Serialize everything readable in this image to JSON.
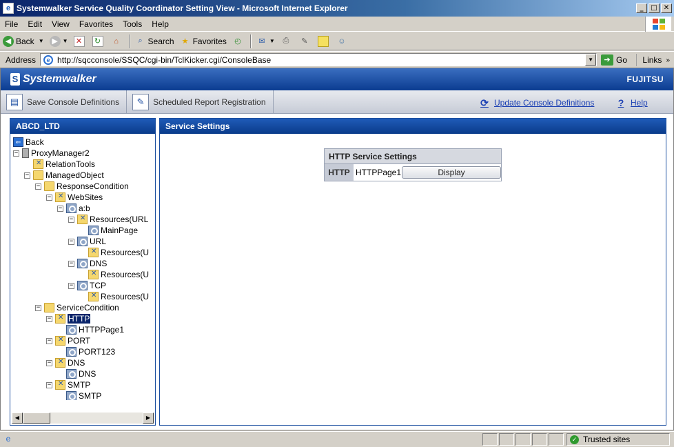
{
  "window": {
    "title": "Systemwalker Service Quality Coordinator Setting View - Microsoft Internet Explorer"
  },
  "menu": [
    "File",
    "Edit",
    "View",
    "Favorites",
    "Tools",
    "Help"
  ],
  "toolbar": {
    "back": "Back",
    "search": "Search",
    "favorites": "Favorites"
  },
  "address": {
    "label": "Address",
    "url": "http://sqcconsole/SSQC/cgi-bin/TclKicker.cgi/ConsoleBase",
    "go": "Go",
    "links": "Links"
  },
  "banner": {
    "product": "Systemwalker",
    "vendor": "FUJITSU"
  },
  "commands": {
    "save": "Save Console Definitions",
    "report": "Scheduled Report Registration",
    "update": "Update Console Definitions",
    "help": "Help"
  },
  "left_panel": {
    "title": "ABCD_LTD"
  },
  "tree": [
    {
      "label": "Back",
      "icon": "back-icon"
    },
    {
      "label": "ProxyManager2",
      "icon": "server-icon"
    },
    {
      "label": "RelationTools",
      "icon": "tool-icon"
    },
    {
      "label": "ManagedObject",
      "icon": "folder-icon"
    },
    {
      "label": "ResponseCondition",
      "icon": "folder-icon"
    },
    {
      "label": "WebSites",
      "icon": "tool-icon"
    },
    {
      "label": "a:b",
      "icon": "object-icon"
    },
    {
      "label": "Resources(URL",
      "icon": "tool-icon"
    },
    {
      "label": "MainPage",
      "icon": "object-icon"
    },
    {
      "label": "URL",
      "icon": "object-icon"
    },
    {
      "label": "Resources(U",
      "icon": "tool-icon"
    },
    {
      "label": "DNS",
      "icon": "object-icon"
    },
    {
      "label": "Resources(U",
      "icon": "tool-icon"
    },
    {
      "label": "TCP",
      "icon": "object-icon"
    },
    {
      "label": "Resources(U",
      "icon": "tool-icon"
    },
    {
      "label": "ServiceCondition",
      "icon": "folder-icon"
    },
    {
      "label": "HTTP",
      "icon": "tool-icon",
      "selected": true
    },
    {
      "label": "HTTPPage1",
      "icon": "object-icon"
    },
    {
      "label": "PORT",
      "icon": "tool-icon"
    },
    {
      "label": "PORT123",
      "icon": "object-icon"
    },
    {
      "label": "DNS",
      "icon": "tool-icon"
    },
    {
      "label": "DNS",
      "icon": "object-icon"
    },
    {
      "label": "SMTP",
      "icon": "tool-icon"
    },
    {
      "label": "SMTP",
      "icon": "object-icon"
    }
  ],
  "main_panel": {
    "title": "Service Settings",
    "table": {
      "header": "HTTP Service Settings",
      "key": "HTTP",
      "value": "HTTPPage1",
      "button": "Display"
    }
  },
  "status": {
    "zone": "Trusted sites"
  }
}
